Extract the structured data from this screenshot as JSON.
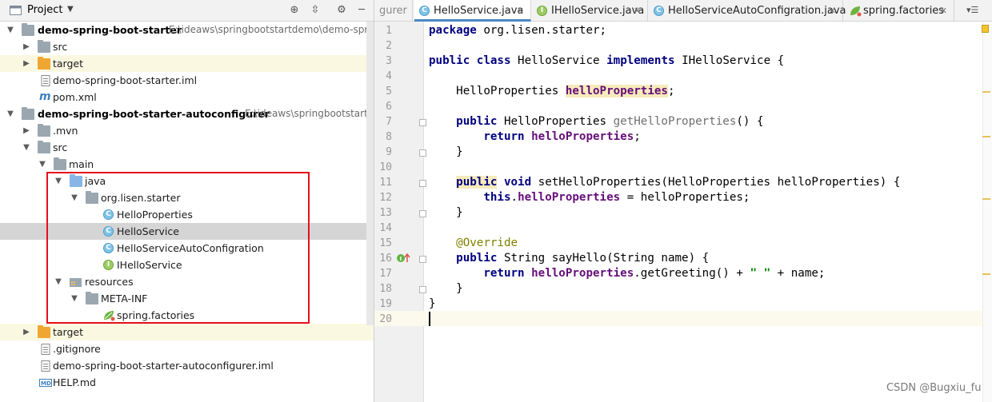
{
  "project": {
    "title": "Project",
    "tree": [
      {
        "label": "demo-spring-boot-starter",
        "path": "E:\\ideaws\\springbootstartdemo\\demo-sprin",
        "bold": true
      },
      {
        "label": "src"
      },
      {
        "label": "target"
      },
      {
        "label": "demo-spring-boot-starter.iml"
      },
      {
        "label": "pom.xml"
      },
      {
        "label": "demo-spring-boot-starter-autoconfigurer",
        "path": "E:\\ideaws\\springbootstartd",
        "bold": true
      },
      {
        "label": ".mvn"
      },
      {
        "label": "src"
      },
      {
        "label": "main"
      },
      {
        "label": "java"
      },
      {
        "label": "org.lisen.starter"
      },
      {
        "label": "HelloProperties"
      },
      {
        "label": "HelloService"
      },
      {
        "label": "HelloServiceAutoConfigration"
      },
      {
        "label": "IHelloService"
      },
      {
        "label": "resources"
      },
      {
        "label": "META-INF"
      },
      {
        "label": "spring.factories"
      },
      {
        "label": "target"
      },
      {
        "label": ".gitignore"
      },
      {
        "label": "demo-spring-boot-starter-autoconfigurer.iml"
      },
      {
        "label": "HELP.md"
      }
    ]
  },
  "tabs": [
    {
      "label": "gurer"
    },
    {
      "label": "HelloService.java"
    },
    {
      "label": "IHelloService.java"
    },
    {
      "label": "HelloServiceAutoConfigration.java"
    },
    {
      "label": "spring.factories"
    }
  ],
  "code": {
    "line_numbers": [
      "1",
      "2",
      "3",
      "4",
      "5",
      "6",
      "7",
      "8",
      "9",
      "10",
      "11",
      "12",
      "13",
      "14",
      "15",
      "16",
      "17",
      "18",
      "19",
      "20"
    ],
    "t": {
      "package": "package",
      "pkg_name": " org.lisen.starter;",
      "public": "public",
      "class": "class",
      "class_name": " HelloService ",
      "implements": "implements",
      "iface": " IHelloService {",
      "indent": "    ",
      "indent2": "        ",
      "type_hp": "HelloProperties ",
      "field": "helloProperties",
      "semi": ";",
      "getter_type": " HelloProperties ",
      "getter": "getHelloProperties",
      "getter_tail": "() {",
      "return": "return",
      "close": "}",
      "close_ind": "    }",
      "void": "void",
      "setter": " setHelloProperties(HelloProperties helloProperties) {",
      "this": "this",
      "dot": ".",
      "assign": " = helloProperties;",
      "override": "@Override",
      "say_hello": " String sayHello(String name) {",
      "greeting": ".getGreeting() + ",
      "space_str": "\" \"",
      "plus_name": " + name;",
      "sp": " "
    }
  },
  "watermark": "CSDN @Bugxiu_fu"
}
